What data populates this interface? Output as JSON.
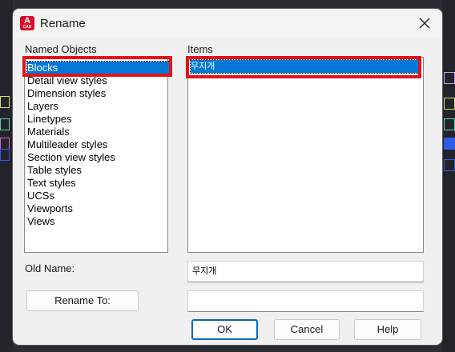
{
  "window": {
    "title": "Rename",
    "app_icon_letter": "A",
    "app_icon_sub": "CAD"
  },
  "named_objects": {
    "label": "Named Objects",
    "items": [
      "Blocks",
      "Detail view styles",
      "Dimension styles",
      "Layers",
      "Linetypes",
      "Materials",
      "Multileader styles",
      "Section view styles",
      "Table styles",
      "Text styles",
      "UCSs",
      "Viewports",
      "Views"
    ],
    "selected_index": 0
  },
  "items_list": {
    "label": "Items",
    "items": [
      "무지개"
    ],
    "selected_index": 0
  },
  "old_name": {
    "label": "Old Name:",
    "value": "무지개"
  },
  "rename_to": {
    "button_label": "Rename To:",
    "value": ""
  },
  "buttons": {
    "ok": "OK",
    "cancel": "Cancel",
    "help": "Help"
  },
  "colors": {
    "selection": "#0078d7",
    "highlight_box": "#e0131b",
    "app_icon": "#d5102b"
  }
}
